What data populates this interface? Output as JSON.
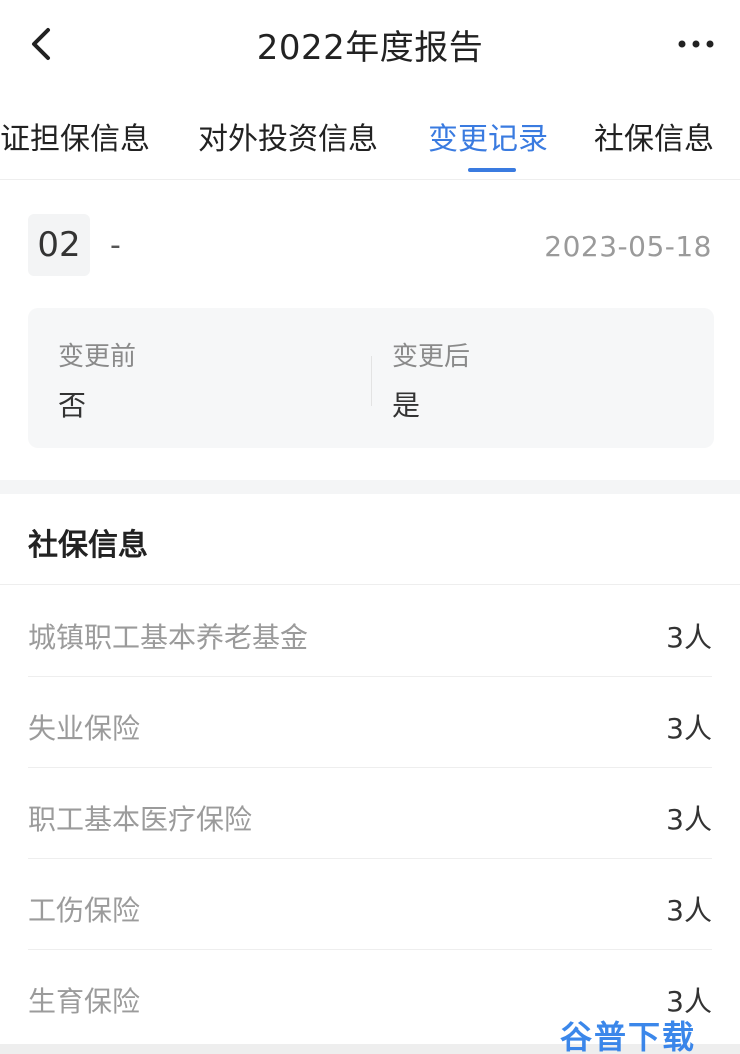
{
  "header": {
    "title": "2022年度报告"
  },
  "tabs": [
    {
      "label": "证担保信息"
    },
    {
      "label": "对外投资信息"
    },
    {
      "label": "变更记录",
      "active": true
    },
    {
      "label": "社保信息"
    }
  ],
  "record": {
    "index": "02",
    "item": "-",
    "date": "2023-05-18",
    "before_label": "变更前",
    "before_value": "否",
    "after_label": "变更后",
    "after_value": "是"
  },
  "social_security": {
    "title": "社保信息",
    "items": [
      {
        "name": "城镇职工基本养老基金",
        "count": "3人"
      },
      {
        "name": "失业保险",
        "count": "3人"
      },
      {
        "name": "职工基本医疗保险",
        "count": "3人"
      },
      {
        "name": "工伤保险",
        "count": "3人"
      },
      {
        "name": "生育保险",
        "count": "3人"
      }
    ]
  },
  "watermark": "谷普下载",
  "colors": {
    "accent": "#3a7be0",
    "muted_text": "#9b9b9b",
    "box_bg": "#f6f7f8"
  }
}
